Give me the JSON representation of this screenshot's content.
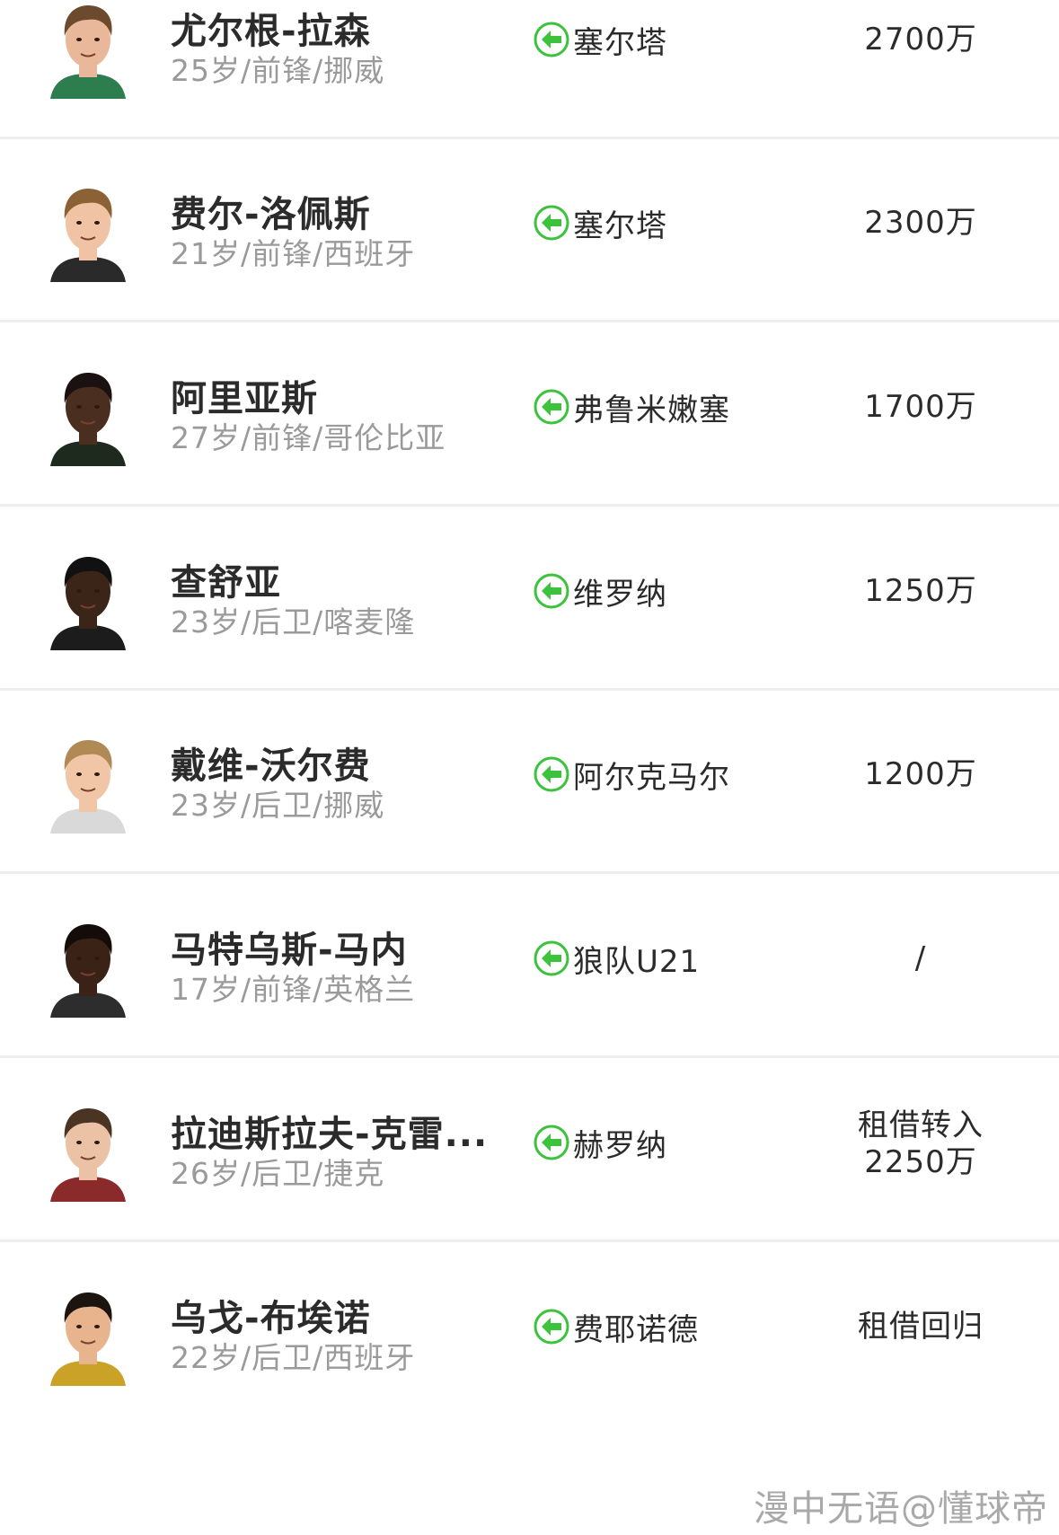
{
  "transfers": [
    {
      "name": "尤尔根-拉森",
      "info": "25岁/前锋/挪威",
      "from_club": "塞尔塔",
      "fee_lines": [
        "2700万"
      ],
      "avatar": {
        "skin": "#e9b89a",
        "hair": "#6b4a2e",
        "shirt": "#2e7d4f"
      }
    },
    {
      "name": "费尔-洛佩斯",
      "info": "21岁/前锋/西班牙",
      "from_club": "塞尔塔",
      "fee_lines": [
        "2300万"
      ],
      "avatar": {
        "skin": "#f0c3a4",
        "hair": "#8b6236",
        "shirt": "#2a2a2a"
      }
    },
    {
      "name": "阿里亚斯",
      "info": "27岁/前锋/哥伦比亚",
      "from_club": "弗鲁米嫩塞",
      "fee_lines": [
        "1700万"
      ],
      "avatar": {
        "skin": "#4a2e20",
        "hair": "#1a1110",
        "shirt": "#1f2a1f"
      }
    },
    {
      "name": "查舒亚",
      "info": "23岁/后卫/喀麦隆",
      "from_club": "维罗纳",
      "fee_lines": [
        "1250万"
      ],
      "avatar": {
        "skin": "#3b2418",
        "hair": "#111111",
        "shirt": "#1c1c1c"
      }
    },
    {
      "name": "戴维-沃尔费",
      "info": "23岁/后卫/挪威",
      "from_club": "阿尔克马尔",
      "fee_lines": [
        "1200万"
      ],
      "avatar": {
        "skin": "#f1c6a6",
        "hair": "#b08a55",
        "shirt": "#d9d9d9"
      }
    },
    {
      "name": "马特乌斯-马内",
      "info": "17岁/前锋/英格兰",
      "from_club": "狼队U21",
      "fee_lines": [
        "/"
      ],
      "avatar": {
        "skin": "#3a2216",
        "hair": "#140c08",
        "shirt": "#2d2d2d"
      }
    },
    {
      "name": "拉迪斯拉夫-克雷...",
      "info": "26岁/后卫/捷克",
      "from_club": "赫罗纳",
      "fee_lines": [
        "租借转入",
        "2250万"
      ],
      "avatar": {
        "skin": "#ebc2a6",
        "hair": "#4a3424",
        "shirt": "#8a2a2a"
      }
    },
    {
      "name": "乌戈-布埃诺",
      "info": "22岁/后卫/西班牙",
      "from_club": "费耶诺德",
      "fee_lines": [
        "租借回归"
      ],
      "avatar": {
        "skin": "#e8b48e",
        "hair": "#1c140e",
        "shirt": "#c9a227"
      }
    }
  ],
  "watermark": "漫中无语@懂球帝",
  "colors": {
    "arrow_green": "#3cc23c",
    "name_text": "#2b2b2b",
    "info_text": "#9a9a9a",
    "divider": "#eeeeee"
  },
  "icons": {
    "transfer_in": "arrow-left-circle-icon"
  }
}
